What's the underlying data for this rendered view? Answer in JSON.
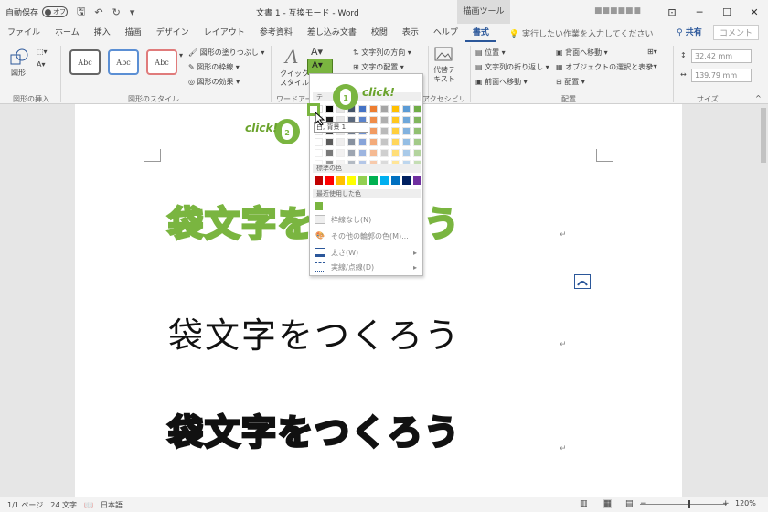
{
  "titlebar": {
    "autosave": "自動保存",
    "toggle": "オフ",
    "doc_title": "文書 1 - 互換モード - Word",
    "tool_tab": "描画ツール",
    "user": "■■■■■■",
    "min": "─",
    "max": "☐",
    "close": "✕"
  },
  "tabs": [
    "ファイル",
    "ホーム",
    "挿入",
    "描画",
    "デザイン",
    "レイアウト",
    "参考資料",
    "差し込み文書",
    "校閲",
    "表示",
    "ヘルプ",
    "書式"
  ],
  "tell_me": "実行したい作業を入力してください",
  "share": "共有",
  "comment": "コメント",
  "ribbon": {
    "insert_shapes_label": "図形の挿入",
    "shape_label": "図形",
    "styles": [
      "Abc",
      "Abc",
      "Abc"
    ],
    "fill": "図形の塗りつぶし",
    "outline": "図形の枠線",
    "effect": "図形の効果",
    "shape_styles_label": "図形のスタイル",
    "quick_style": "クイック\nスタイル",
    "wordart_label": "ワードアートの",
    "text_direction": "文字列の方向",
    "text_align": "文字の配置",
    "alt_text": "代替テ\nキスト",
    "accessibility_label": "アクセシビリ",
    "position": "位置",
    "wrap": "文字列の折り返し",
    "bring_forward": "前面へ移動",
    "send_backward": "背面へ移動",
    "select_pane": "オブジェクトの選択と表示",
    "align": "配置",
    "arrange_label": "配置",
    "height": "32.42 mm",
    "width": "139.79 mm",
    "size_label": "サイズ"
  },
  "document": {
    "line1": "袋文字をつくろう",
    "line2": "袋文字をつくろう",
    "line3": "袋文字をつくろう"
  },
  "dropdown": {
    "theme_header": "テ",
    "tooltip": "白, 背景 1",
    "standard_header": "標準の色",
    "recent_header": "最近使用した色",
    "no_outline": "枠線なし(N)",
    "more_colors": "その他の輪郭の色(M)...",
    "weight": "太さ(W)",
    "dashes": "実線/点線(D)"
  },
  "callouts": {
    "click1": "click!",
    "click2": "click!",
    "n1": "1",
    "n2": "2"
  },
  "status": {
    "page": "1/1 ページ",
    "words": "24 文字",
    "lang": "日本語",
    "zoom": "120%"
  },
  "colors": {
    "accent": "#2b579a",
    "green": "#7ab540"
  }
}
